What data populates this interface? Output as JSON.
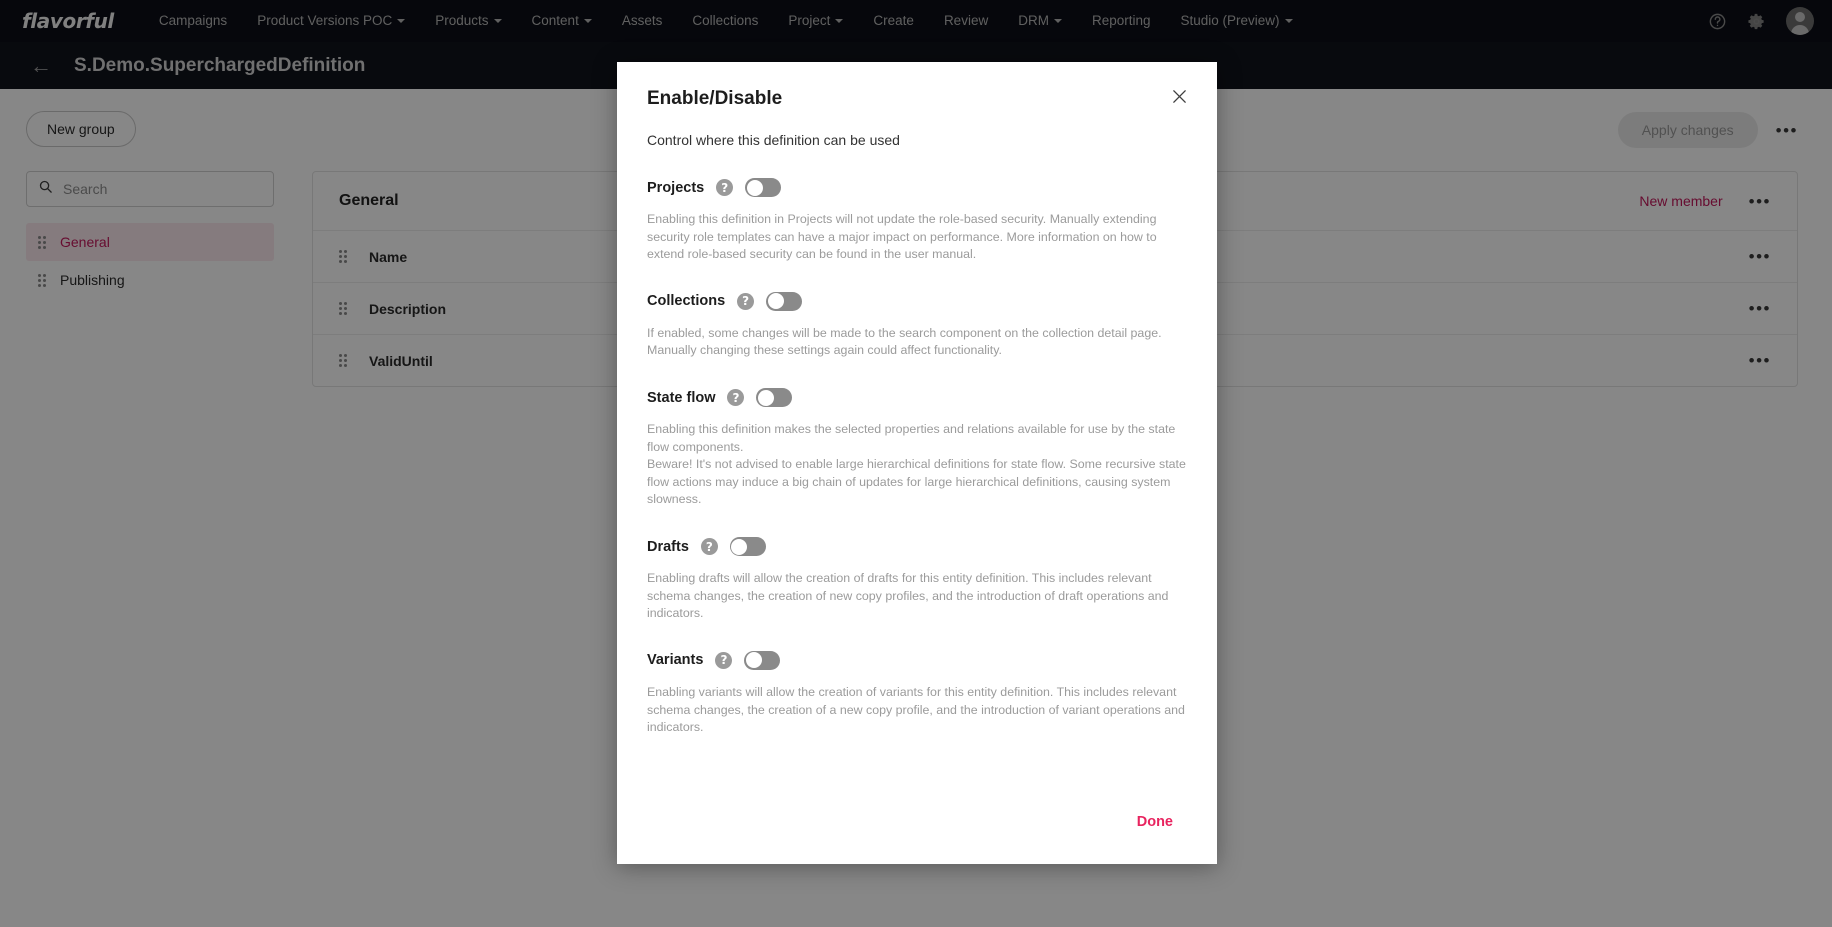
{
  "topnav": {
    "brand": "flavorful",
    "items": [
      {
        "label": "Campaigns",
        "caret": false
      },
      {
        "label": "Product Versions POC",
        "caret": true
      },
      {
        "label": "Products",
        "caret": true
      },
      {
        "label": "Content",
        "caret": true
      },
      {
        "label": "Assets",
        "caret": false
      },
      {
        "label": "Collections",
        "caret": false
      },
      {
        "label": "Project",
        "caret": true
      },
      {
        "label": "Create",
        "caret": false
      },
      {
        "label": "Review",
        "caret": false
      },
      {
        "label": "DRM",
        "caret": true
      },
      {
        "label": "Reporting",
        "caret": false
      },
      {
        "label": "Studio (Preview)",
        "caret": true
      }
    ],
    "help_icon": "help-circle-icon",
    "settings_icon": "gear-icon",
    "avatar_icon": "user-avatar-icon"
  },
  "subheader": {
    "back_icon": "back-arrow-icon",
    "title": "S.Demo.SuperchargedDefinition"
  },
  "sidebar": {
    "new_group_label": "New group",
    "search": {
      "value": "",
      "placeholder": "Search",
      "icon": "search-icon"
    },
    "items": [
      {
        "label": "General",
        "active": true
      },
      {
        "label": "Publishing",
        "active": false
      }
    ]
  },
  "main": {
    "toolbar": {
      "apply_label": "Apply changes",
      "overflow": "•••"
    },
    "panel": {
      "title": "General",
      "new_member_label": "New member",
      "overflow": "•••",
      "rows": [
        {
          "name": "Name",
          "overflow": "•••"
        },
        {
          "name": "Description",
          "overflow": "•••"
        },
        {
          "name": "ValidUntil",
          "overflow": "•••"
        }
      ]
    }
  },
  "modal": {
    "title": "Enable/Disable",
    "subtitle": "Control where this definition can be used",
    "close_icon": "close-icon",
    "done_label": "Done",
    "options": [
      {
        "label": "Projects",
        "help_icon": "help-icon",
        "toggle_state": "off",
        "description": "Enabling this definition in Projects will not update the role-based security. Manually extending security role templates can have a major impact on performance. More information on how to extend role-based security can be found in the user manual."
      },
      {
        "label": "Collections",
        "help_icon": "help-icon",
        "toggle_state": "off",
        "description": "If enabled, some changes will be made to the search component on the collection detail page. Manually changing these settings again could affect functionality."
      },
      {
        "label": "State flow",
        "help_icon": "help-icon",
        "toggle_state": "off",
        "description": "Enabling this definition makes the selected properties and relations available for use by the state flow components.\nBeware! It's not advised to enable large hierarchical definitions for state flow. Some recursive state flow actions may induce a big chain of updates for large hierarchical definitions, causing system slowness."
      },
      {
        "label": "Drafts",
        "help_icon": "help-icon",
        "toggle_state": "off",
        "description": "Enabling drafts will allow the creation of drafts for this entity definition. This includes relevant schema changes, the creation of new copy profiles, and the introduction of draft operations and indicators."
      },
      {
        "label": "Variants",
        "help_icon": "help-icon",
        "toggle_state": "off",
        "description": "Enabling variants will allow the creation of variants for this entity definition. This includes relevant schema changes, the creation of a new copy profile, and the introduction of variant operations and indicators."
      }
    ]
  },
  "colors": {
    "accent_pink": "#c2185b",
    "done_pink": "#e8245f",
    "nav_dark": "#0c0f17",
    "subheader_dark": "#10131c",
    "toggle_off_track": "#8a8a8a"
  }
}
